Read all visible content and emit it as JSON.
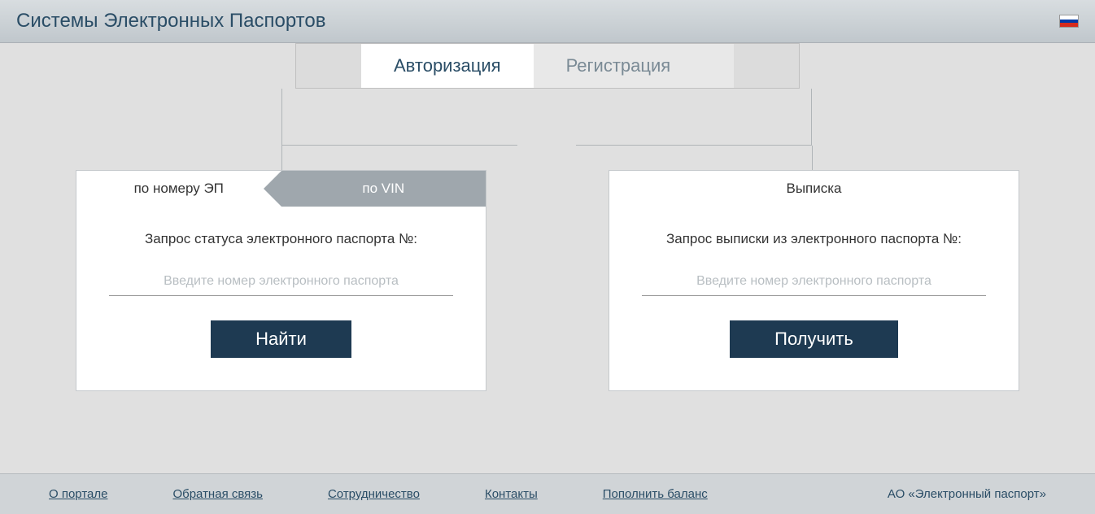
{
  "header": {
    "title": "Системы Электронных Паспортов"
  },
  "auth": {
    "login": "Авторизация",
    "register": "Регистрация"
  },
  "left_card": {
    "tab_ep": "по номеру ЭП",
    "tab_vin": "по VIN",
    "label": "Запрос статуса электронного паспорта №:",
    "placeholder": "Введите номер электронного паспорта",
    "button": "Найти"
  },
  "right_card": {
    "tab": "Выписка",
    "label": "Запрос выписки из электронного паспорта №:",
    "placeholder": "Введите номер электронного паспорта",
    "button": "Получить"
  },
  "footer": {
    "links": {
      "about": "О портале",
      "feedback": "Обратная связь",
      "cooperation": "Сотрудничество",
      "contacts": "Контакты",
      "balance": "Пополнить баланс"
    },
    "company": "АО «Электронный паспорт»"
  }
}
